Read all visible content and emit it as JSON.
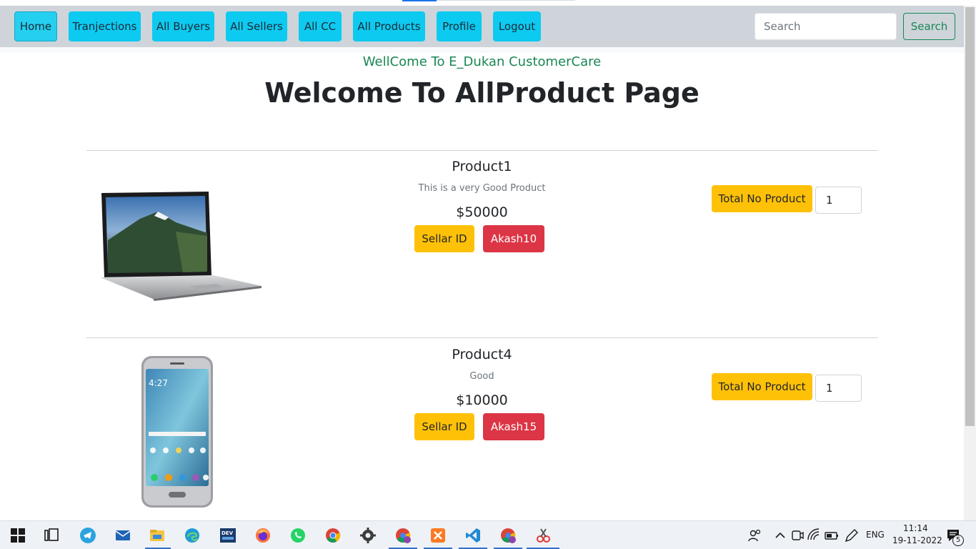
{
  "nav": {
    "items": [
      {
        "label": "Home"
      },
      {
        "label": "Tranjections"
      },
      {
        "label": "All Buyers"
      },
      {
        "label": "All Sellers"
      },
      {
        "label": "All CC"
      },
      {
        "label": "All Products"
      },
      {
        "label": "Profile"
      },
      {
        "label": "Logout"
      }
    ],
    "search_placeholder": "Search",
    "search_button": "Search"
  },
  "page": {
    "greeting": "WellCome To E_Dukan CustomerCare",
    "title": "Welcome To AllProduct Page"
  },
  "products": [
    {
      "name": "Product1",
      "description": "This is a very Good Product",
      "price": "$50000",
      "seller_label": "Sellar ID",
      "seller_id": "Akash10",
      "total_label": "Total No Product",
      "quantity": "1",
      "image_icon": "laptop-image"
    },
    {
      "name": "Product4",
      "description": "Good",
      "price": "$10000",
      "seller_label": "Sellar ID",
      "seller_id": "Akash15",
      "total_label": "Total No Product",
      "quantity": "1",
      "image_icon": "smartphone-image"
    }
  ],
  "taskbar": {
    "language": "ENG",
    "time": "11:14",
    "date": "19-11-2022",
    "notification_count": "5"
  },
  "colors": {
    "nav_button": "#0dcaf0",
    "search_button": "#198754",
    "greeting": "#198754",
    "seller_label_button": "#ffc107",
    "seller_id_button": "#dc3545"
  }
}
